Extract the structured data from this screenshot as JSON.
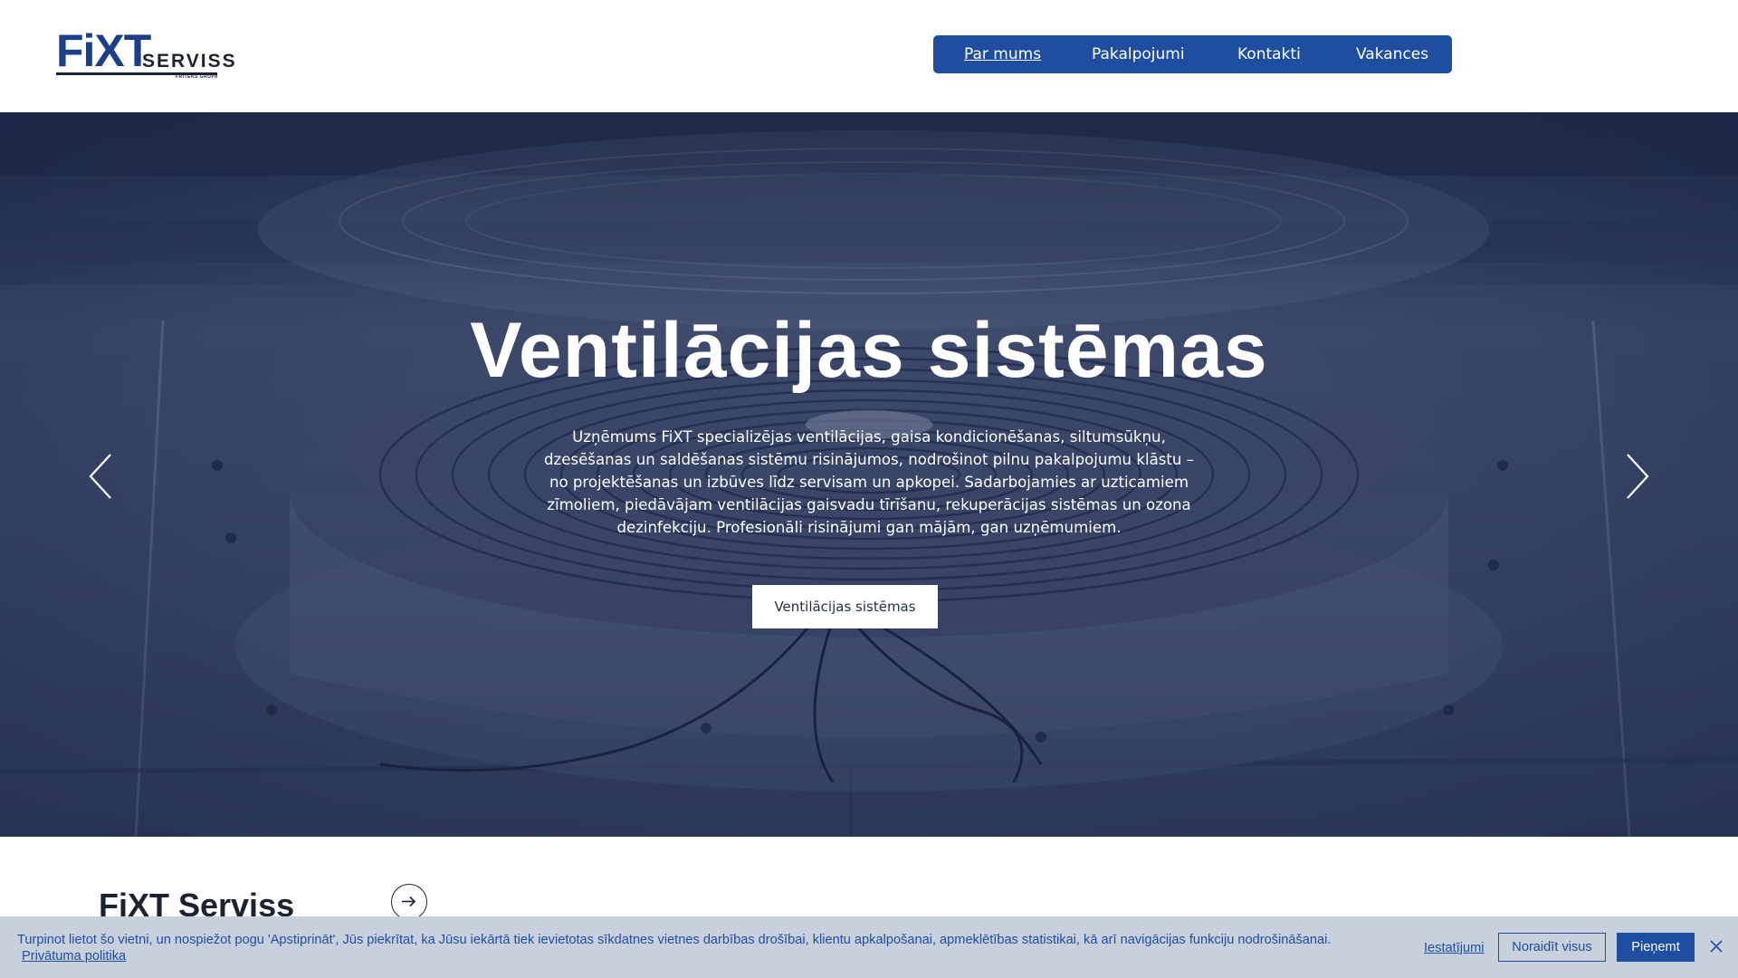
{
  "logo": {
    "brand": "FiXT",
    "suffix": "SERVISS",
    "group": "FRITEKS GRUPA"
  },
  "nav": {
    "items": [
      {
        "label": "Par mums",
        "active": true
      },
      {
        "label": "Pakalpojumi",
        "active": false
      },
      {
        "label": "Kontakti",
        "active": false
      },
      {
        "label": "Vakances",
        "active": false
      }
    ]
  },
  "hero": {
    "title": "Ventilācijas sistēmas",
    "text": "Uzņēmums FiXT specializējas ventilācijas, gaisa kondicionēšanas, siltumsūkņu, dzesēšanas un saldēšanas sistēmu risinājumos, nodrošinot pilnu pakalpojumu klāstu – no projektēšanas un izbūves līdz servisam un apkopei. Sadarbojamies ar uzticamiem zīmoliem, piedāvājam ventilācijas gaisvadu tīrīšanu, rekuperācijas sistēmas un ozona dezinfekciju. Profesionāli risinājumi gan mājām, gan uzņēmumiem.",
    "button_label": "Ventilācijas sistēmas",
    "prev_icon": "chevron-left-icon",
    "next_icon": "chevron-right-icon"
  },
  "section": {
    "title": "FiXT Serviss",
    "arrow_icon": "arrow-right-circle-icon"
  },
  "cookie": {
    "text": "Turpinot lietot šo vietni, un nospiežot pogu 'Apstiprināt', Jūs piekrītat, ka Jūsu iekārtā tiek ievietotas sīkdatnes vietnes darbības drošībai, klientu apkalpošanai, apmeklētības statistikai, kā arī navigācijas funkciju nodrošināšanai.",
    "privacy_link": "Privātuma politika",
    "settings_label": "Iestatījumi",
    "reject_label": "Noraidīt visus",
    "accept_label": "Pieņemt",
    "close_icon": "close-icon"
  },
  "colors": {
    "brand_blue": "#1f4ea1",
    "dark_navy": "#1b2333",
    "hero_overlay": "#2a3a63",
    "cookie_bg": "#c9d0dd"
  }
}
